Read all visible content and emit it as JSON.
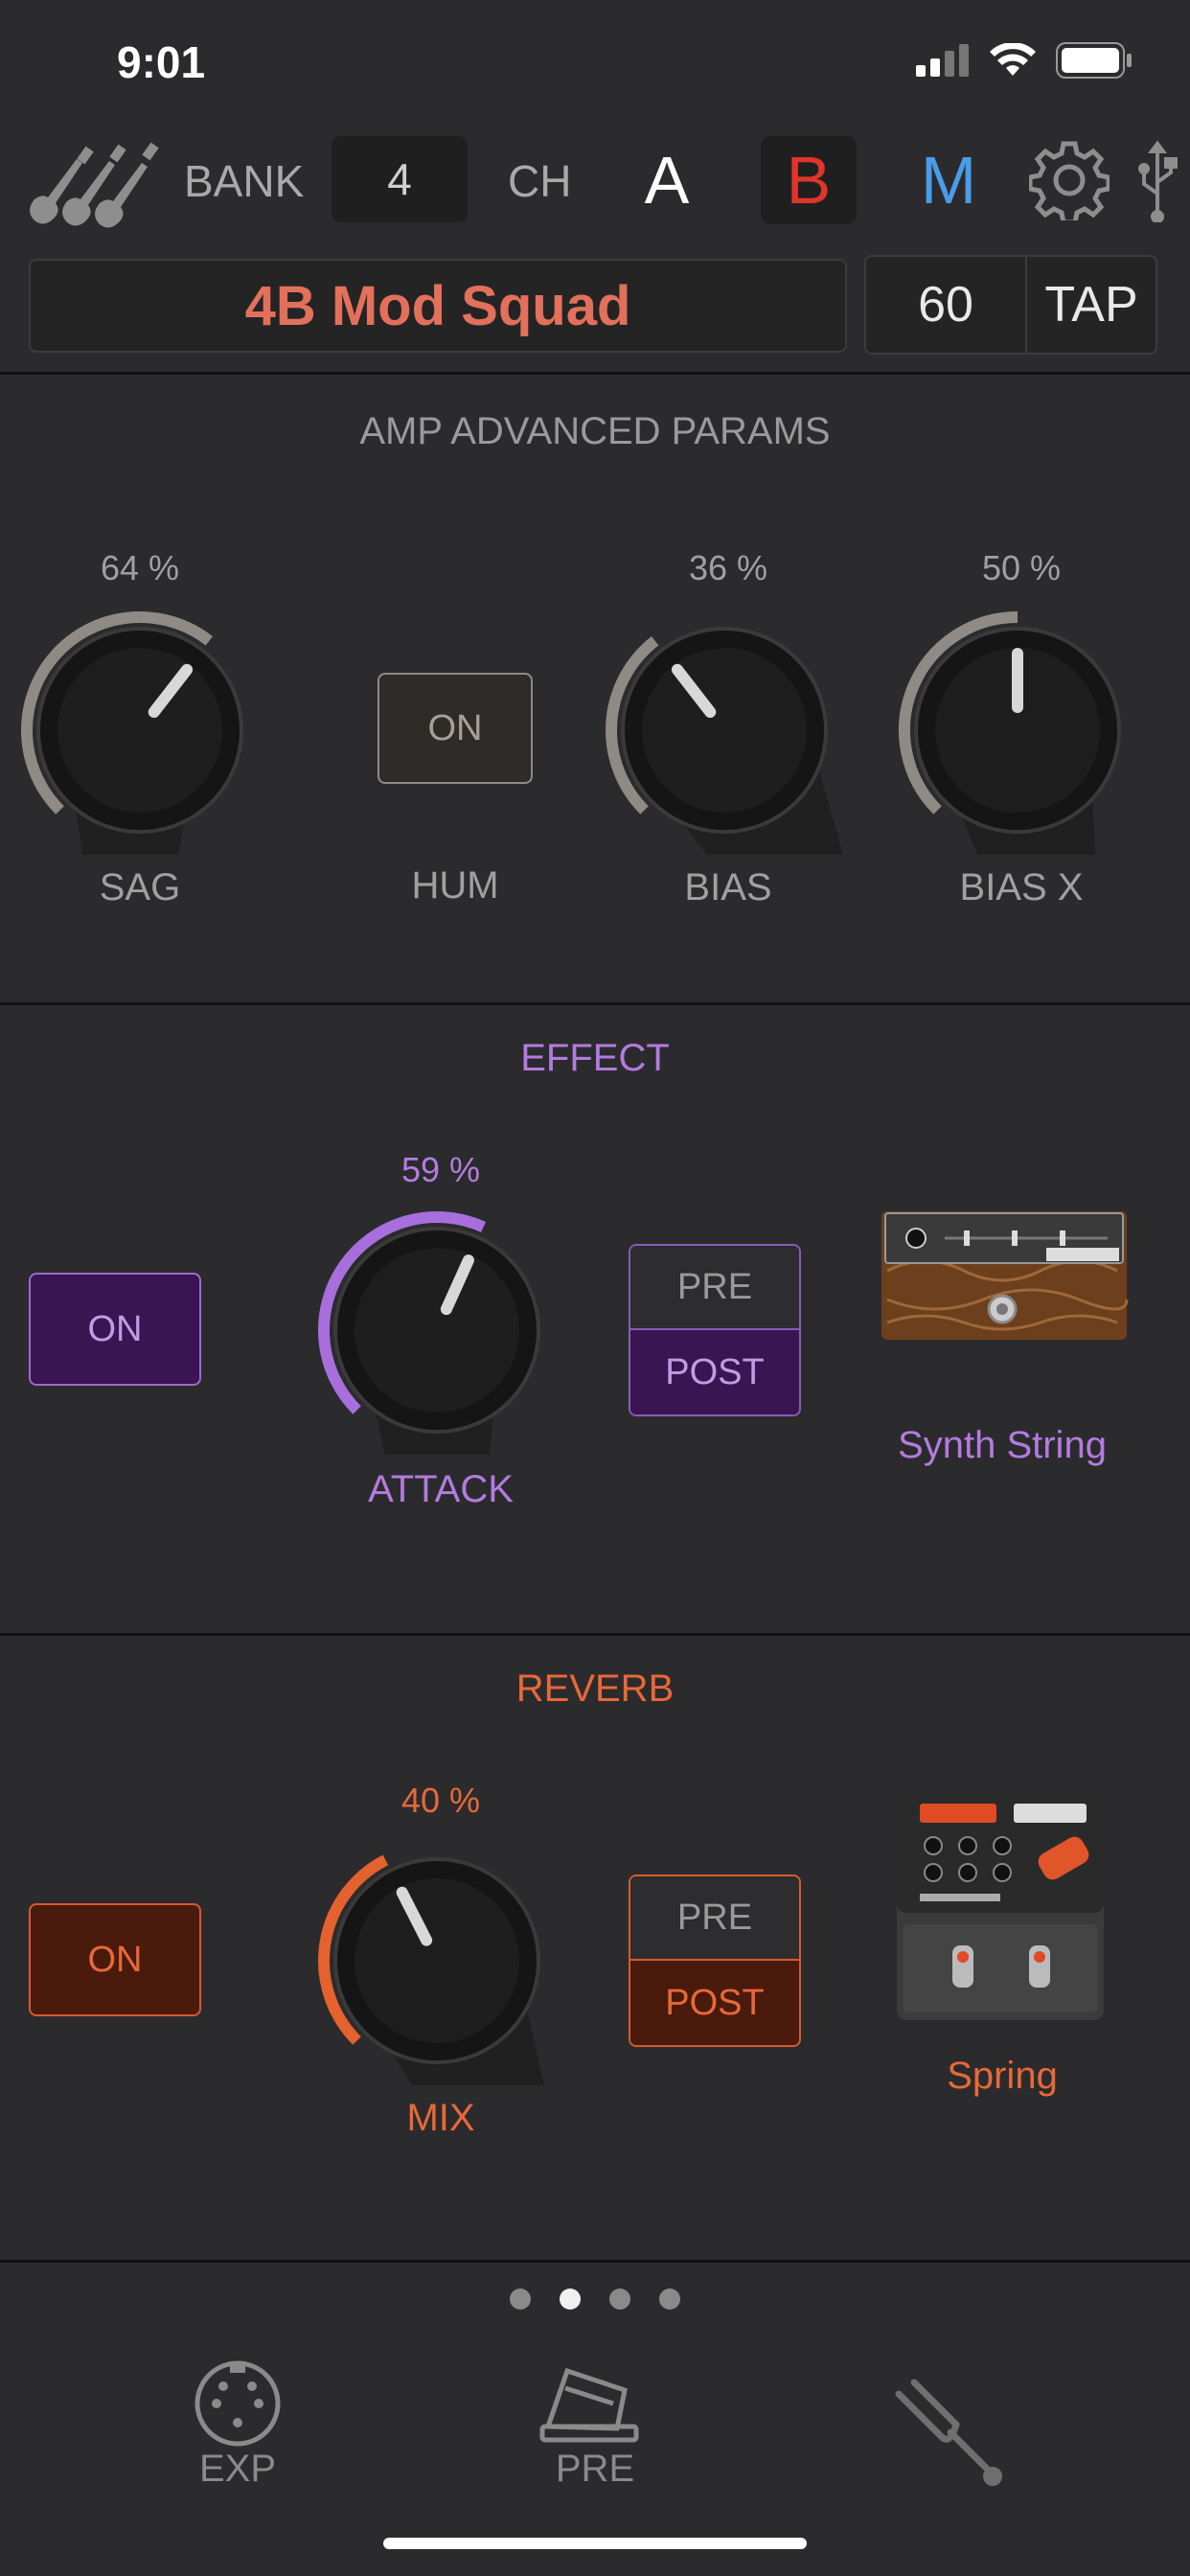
{
  "status": {
    "time": "9:01"
  },
  "topbar": {
    "bank_label": "BANK",
    "bank_value": "4",
    "ch_label": "CH",
    "channels": [
      "A",
      "B",
      "M"
    ],
    "active_channel": "B"
  },
  "preset": {
    "name": "4B Mod Squad",
    "tempo": "60",
    "tap_label": "TAP"
  },
  "amp": {
    "title": "AMP ADVANCED PARAMS",
    "sag": {
      "label": "SAG",
      "value": "64 %",
      "level": 64
    },
    "hum": {
      "label": "HUM",
      "button": "ON"
    },
    "bias": {
      "label": "BIAS",
      "value": "36 %",
      "level": 36
    },
    "biasx": {
      "label": "BIAS X",
      "value": "50 %",
      "level": 50
    }
  },
  "effect": {
    "title": "EFFECT",
    "on_label": "ON",
    "knob": {
      "label": "ATTACK",
      "value": "59 %",
      "level": 59
    },
    "pre_label": "PRE",
    "post_label": "POST",
    "model": "Synth String",
    "color": "#b47be0"
  },
  "reverb": {
    "title": "REVERB",
    "on_label": "ON",
    "knob": {
      "label": "MIX",
      "value": "40 %",
      "level": 40
    },
    "pre_label": "PRE",
    "post_label": "POST",
    "model": "Spring",
    "color": "#e8683a"
  },
  "pager": {
    "count": 4,
    "active": 2
  },
  "tabs": [
    {
      "label": "EXP",
      "icon": "midi-din-icon"
    },
    {
      "label": "PRE",
      "icon": "pedal-icon"
    },
    {
      "label": "",
      "icon": "tuning-fork-icon"
    }
  ]
}
